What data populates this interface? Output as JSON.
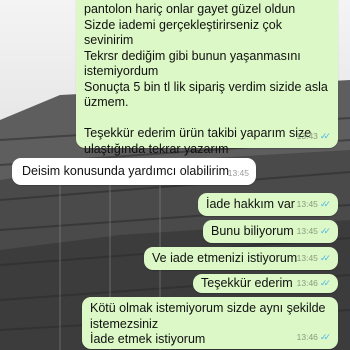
{
  "messages": [
    {
      "direction": "outgoing",
      "text": "pantolon hariç onlar gayet güzel oldun\nSizde iademi gerçekleştirirseniz çok sevinirim\nTekrsr dediğim gibi bunun yaşanmasını istemiyordum\nSonuçta 5 bin tl lik sipariş verdim sizide asla üzmem.\n\nTeşekkür ederim ürün takibi yaparım size ulaştığında tekrar yazarım",
      "time": "13:43",
      "status_icon": "double-check-icon",
      "status_color": "#4fb7e8"
    },
    {
      "direction": "incoming",
      "text": "Deisim konusunda yardımcı olabilirim",
      "time": "13:45"
    },
    {
      "direction": "outgoing",
      "text": "İade hakkım var",
      "time": "13:45",
      "status_icon": "double-check-icon"
    },
    {
      "direction": "outgoing",
      "text": "Bunu biliyorum",
      "time": "13:45",
      "status_icon": "double-check-icon"
    },
    {
      "direction": "outgoing",
      "text": "Ve iade etmenizi istiyorum",
      "time": "13:45",
      "status_icon": "double-check-icon"
    },
    {
      "direction": "outgoing",
      "text": "Teşekkür ederim",
      "time": "13:46",
      "status_icon": "double-check-icon"
    },
    {
      "direction": "outgoing",
      "text": "Kötü olmak istemiyorum sizde aynı şekilde istemezsiniz\nİade etmek istiyorum",
      "time": "13:46",
      "status_icon": "double-check-icon"
    }
  ],
  "colors": {
    "outgoing_bubble": "#dcf8c6",
    "incoming_bubble": "#ffffff",
    "read_ticks": "#4fb7e8"
  }
}
